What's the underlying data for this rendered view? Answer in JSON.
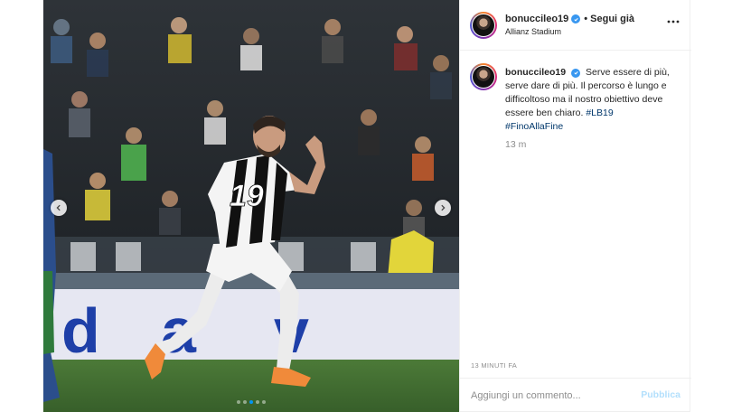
{
  "header": {
    "username": "bonuccileo19",
    "follow_status": "Segui già",
    "separator": "•",
    "location": "Allianz Stadium"
  },
  "photo": {
    "jersey_number": "19",
    "carousel_total": 5,
    "carousel_active": 3
  },
  "caption": {
    "username": "bonuccileo19",
    "text": "Serve essere di più, serve dare di più. Il percorso è lungo e difficoltoso ma il nostro obiettivo deve essere ben chiaro.",
    "hashtags": [
      "#LB19",
      "#FinoAllaFine"
    ],
    "time": "13 m"
  },
  "post_time": "13 MINUTI FA",
  "comment_box": {
    "placeholder": "Aggiungi un commento...",
    "publish_label": "Pubblica"
  },
  "colors": {
    "accent": "#0095f6",
    "verified": "#3897f0",
    "publish_disabled": "#b2dffc",
    "hashtag": "#00376b",
    "jersey_white": "#f4f4f4",
    "jersey_black": "#111111",
    "pitch": "#3f6b2f",
    "ad_board": "#e6e7f2"
  },
  "icons": [
    "verified-badge-icon",
    "more-options-icon",
    "chevron-left-icon",
    "chevron-right-icon"
  ]
}
